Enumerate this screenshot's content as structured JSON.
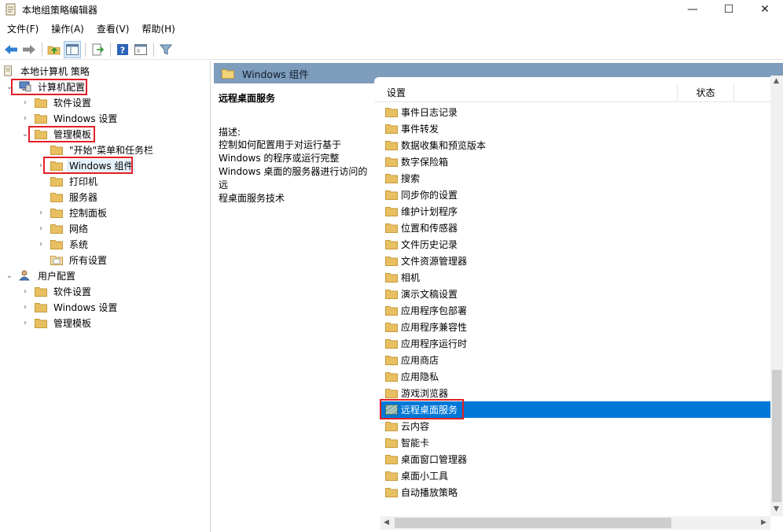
{
  "window": {
    "title": "本地组策略编辑器",
    "minimize": "—",
    "maximize": "☐",
    "close": "✕"
  },
  "menu": [
    "文件(F)",
    "操作(A)",
    "查看(V)",
    "帮助(H)"
  ],
  "toolbar": [
    "back-arrow-icon",
    "forward-arrow-icon",
    "up-folder-icon",
    "show-hide-tree-icon",
    "export-list-icon",
    "help-icon",
    "properties-icon",
    "filter-icon"
  ],
  "tree": {
    "root": "本地计算机 策略",
    "computer_config": "计算机配置",
    "cc_software": "软件设置",
    "cc_windows": "Windows 设置",
    "cc_admin": "管理模板",
    "at_start": "\"开始\"菜单和任务栏",
    "at_windows": "Windows 组件",
    "at_printer": "打印机",
    "at_server": "服务器",
    "at_control": "控制面板",
    "at_network": "网络",
    "at_system": "系统",
    "at_all": "所有设置",
    "user_config": "用户配置",
    "uc_software": "软件设置",
    "uc_windows": "Windows 设置",
    "uc_admin": "管理模板"
  },
  "right": {
    "header": "Windows 组件",
    "desc_title": "远程桌面服务",
    "desc_label": "描述:",
    "desc_lines": [
      "控制如何配置用于对运行基于",
      "Windows 的程序或运行完整",
      "Windows 桌面的服务器进行访问的远",
      "程桌面服务技术"
    ],
    "col_settings": "设置",
    "col_status": "状态",
    "items": [
      "事件日志记录",
      "事件转发",
      "数据收集和预览版本",
      "数字保险箱",
      "搜索",
      "同步你的设置",
      "维护计划程序",
      "位置和传感器",
      "文件历史记录",
      "文件资源管理器",
      "相机",
      "演示文稿设置",
      "应用程序包部署",
      "应用程序兼容性",
      "应用程序运行时",
      "应用商店",
      "应用隐私",
      "游戏浏览器",
      "远程桌面服务",
      "云内容",
      "智能卡",
      "桌面窗口管理器",
      "桌面小工具",
      "自动播放策略"
    ],
    "selected_index": 18
  },
  "colors": {
    "accent": "#0078d7",
    "highlight_box": "#e21f26",
    "pane_header": "#7e9cbb",
    "folder": "#e8c062"
  }
}
